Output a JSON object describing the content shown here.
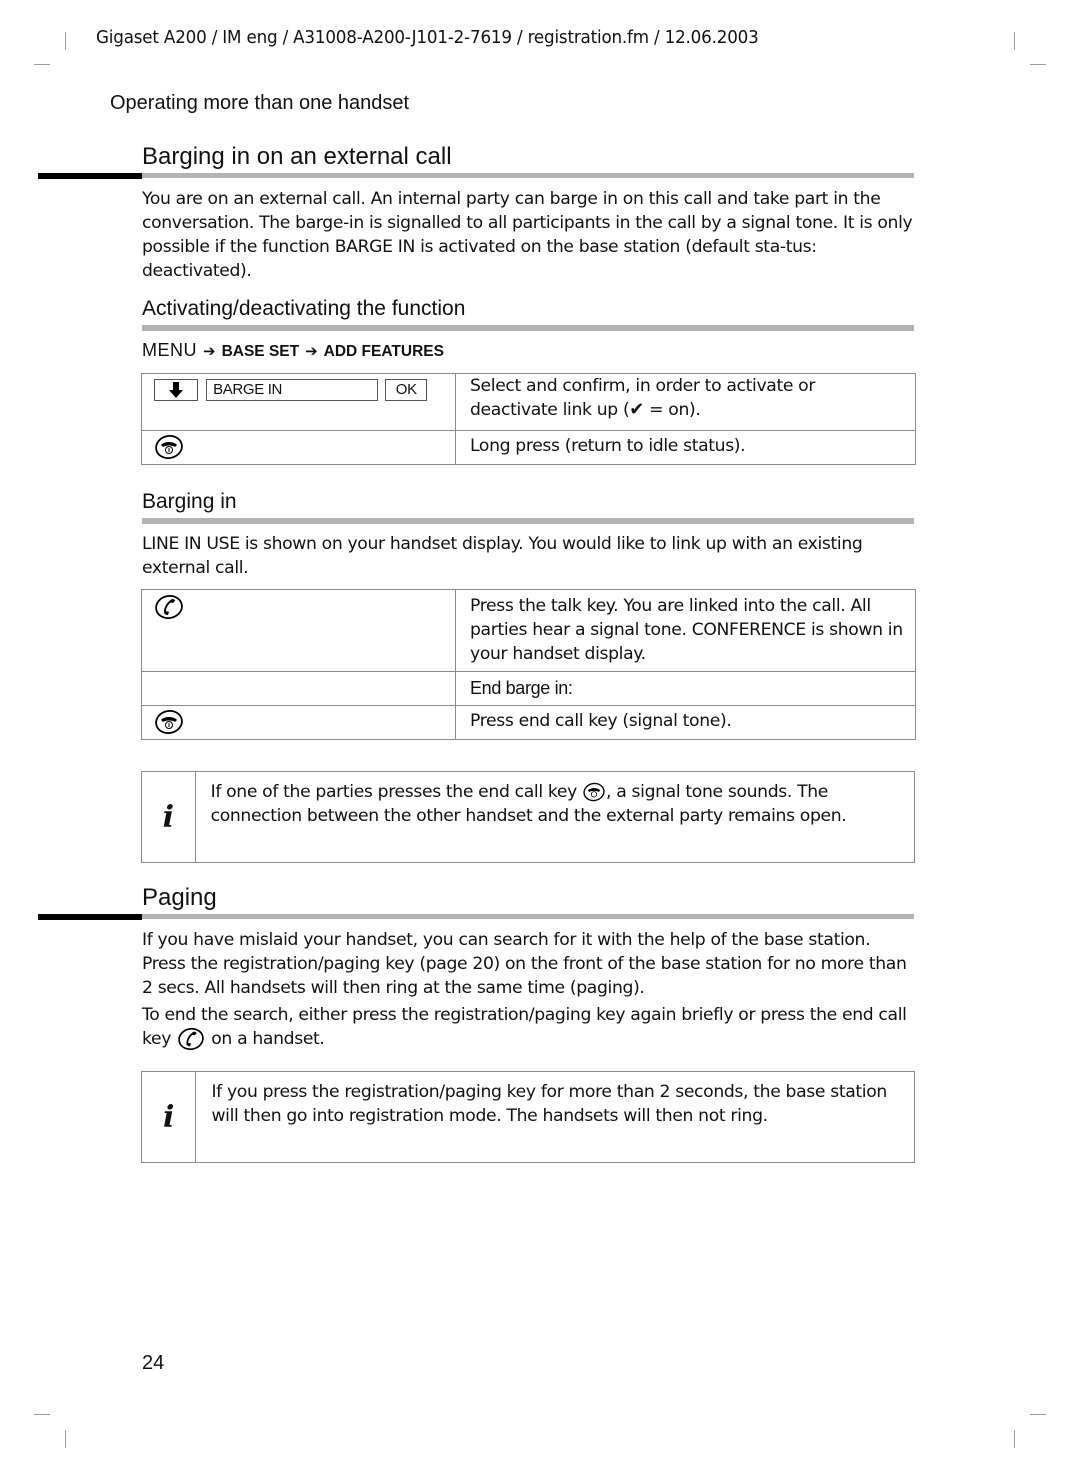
{
  "header": {
    "doc_info": "Gigaset A200 / IM eng / A31008-A200-J101-2-7619 / registration.fm / 12.06.2003"
  },
  "running_title": "Operating more than one handset",
  "section_barging": {
    "title": "Barging in on an external call",
    "intro": "You are on an external call. An internal party can barge in on this call and take part in the conversation. The barge-in is signalled to all participants in the call by a signal tone. It is only possible if the function BARGE IN is activated on the base station (default sta-tus: deactivated).",
    "activating": {
      "title": "Activating/deactivating the function",
      "menu_path": {
        "menu": "MENU",
        "arrow_icon": "right-arrow-icon",
        "item1": "BASE SET",
        "item2": "ADD FEATURES"
      },
      "steps": [
        {
          "keys": {
            "nav_icon": "down-arrow-icon",
            "display": "BARGE IN",
            "softkey": "OK"
          },
          "text_before": "Select and confirm, in order to activate or deactivate link up (",
          "check_icon": "checkmark-icon",
          "text_after": " = on)."
        },
        {
          "key_icon": "end-call-key-icon",
          "text": "Long press (return to idle status)."
        }
      ]
    },
    "barging_in": {
      "title": "Barging in",
      "intro": "LINE IN USE is shown on your handset display. You would like to link up with an existing external call.",
      "steps": [
        {
          "key_icon": "talk-key-icon",
          "text": "Press the talk key. You are linked into the call. All parties hear a signal tone. CONFERENCE is shown in your handset display."
        },
        {
          "key_icon": "",
          "text": "End barge in:"
        },
        {
          "key_icon": "end-call-key-icon",
          "text": "Press end call key (signal tone)."
        }
      ]
    },
    "info_note": {
      "icon": "info-icon",
      "icon_glyph": "i",
      "text_before": "If one of the parties presses the end call key ",
      "key_icon": "end-call-key-icon",
      "text_after": ", a signal tone sounds. The connection between the other handset and the external party remains open."
    }
  },
  "section_paging": {
    "title": "Paging",
    "para1": "If you have mislaid your handset, you can search for it with the help of the base station. Press the registration/paging key (page 20) on the front of the base station for no more than 2 secs. All handsets will then ring at the same time (paging).",
    "para2_before": "To end the search, either press the registration/paging key again briefly or press the end call key ",
    "para2_key_icon": "talk-key-icon",
    "para2_after": " on a handset.",
    "info_note": {
      "icon": "info-icon",
      "icon_glyph": "i",
      "text": "If you press the registration/paging key for more than 2 seconds, the base station will then go into registration mode. The handsets will then not ring."
    }
  },
  "footer": {
    "page_number": "24"
  }
}
